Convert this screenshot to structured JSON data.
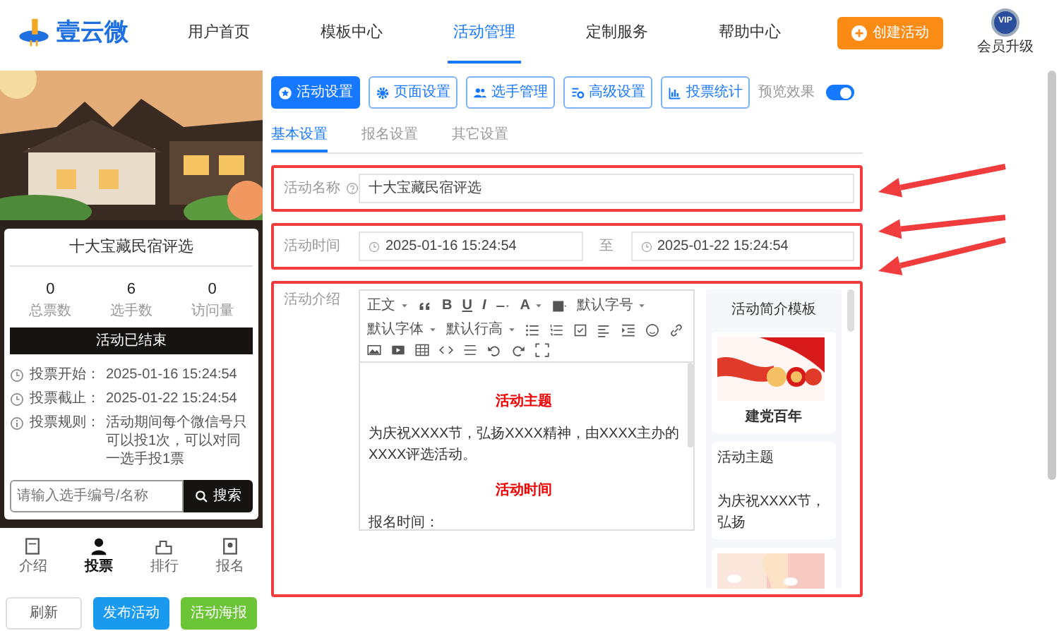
{
  "header": {
    "logo": "壹云微",
    "nav": [
      {
        "label": "用户首页",
        "selected": false
      },
      {
        "label": "模板中心",
        "selected": false
      },
      {
        "label": "活动管理",
        "selected": true
      },
      {
        "label": "定制服务",
        "selected": false
      },
      {
        "label": "帮助中心",
        "selected": false
      }
    ],
    "create_button": "创建活动",
    "vip_badge": "VIP",
    "vip_label": "会员升级"
  },
  "preview": {
    "kind": "picture",
    "card_title": "十大宝藏民宿评选",
    "stats": [
      {
        "value": "0",
        "label": "总票数"
      },
      {
        "value": "6",
        "label": "选手数"
      },
      {
        "value": "0",
        "label": "访问量"
      }
    ],
    "status": "活动已结束",
    "info": [
      {
        "kind": "clock",
        "label": "投票开始：",
        "value": "2025-01-16 15:24:54"
      },
      {
        "kind": "clock",
        "label": "投票截止：",
        "value": "2025-01-22 15:24:54"
      },
      {
        "kind": "info",
        "label": "投票规则：",
        "value": "活动期间每个微信号只可以投1次，可以对同一选手投1票"
      }
    ],
    "search": {
      "placeholder": "请输入选手编号/名称",
      "button": "搜索"
    },
    "bottom_nav": [
      {
        "label": "介绍",
        "selected": false
      },
      {
        "label": "投票",
        "selected": true
      },
      {
        "label": "排行",
        "selected": false
      },
      {
        "label": "报名",
        "selected": false
      }
    ]
  },
  "actions": [
    {
      "label": "刷新",
      "kind": "outline"
    },
    {
      "label": "发布活动",
      "kind": "blue"
    },
    {
      "label": "活动海报",
      "kind": "green"
    }
  ],
  "toolbar": [
    {
      "label": "活动设置",
      "selected": true
    },
    {
      "label": "页面设置",
      "selected": false
    },
    {
      "label": "选手管理",
      "selected": false
    },
    {
      "label": "高级设置",
      "selected": false
    },
    {
      "label": "投票统计",
      "selected": false
    }
  ],
  "preview_toggle": {
    "label": "预览效果",
    "on": true
  },
  "tabs": [
    {
      "label": "基本设置",
      "selected": true
    },
    {
      "label": "报名设置",
      "selected": false
    },
    {
      "label": "其它设置",
      "selected": false
    }
  ],
  "form": {
    "name_label": "活动名称",
    "name_value": "十大宝藏民宿评选",
    "time_label": "活动时间",
    "start": "2025-01-16 15:24:54",
    "separator": "至",
    "end": "2025-01-22 15:24:54",
    "intro_label": "活动介绍"
  },
  "editor": {
    "menus": [
      "正文",
      "默认字号",
      "默认字体",
      "默认行高"
    ],
    "glyphs": [
      "B",
      "U",
      "I",
      "A"
    ],
    "content": [
      {
        "kind": "heading",
        "text": "活动主题"
      },
      {
        "kind": "para",
        "text": "为庆祝XXXX节，弘扬XXXX精神，由XXXX主办的XXXX评选活动。"
      },
      {
        "kind": "heading",
        "text": "活动时间"
      },
      {
        "kind": "para",
        "text": "报名时间："
      }
    ]
  },
  "templates": {
    "title": "活动简介模板",
    "items": [
      {
        "kind": "picture",
        "caption": "建党百年"
      },
      {
        "kind": "text",
        "title": "活动主题",
        "text": "为庆祝XXXX节，弘扬"
      },
      {
        "kind": "picture"
      }
    ]
  }
}
